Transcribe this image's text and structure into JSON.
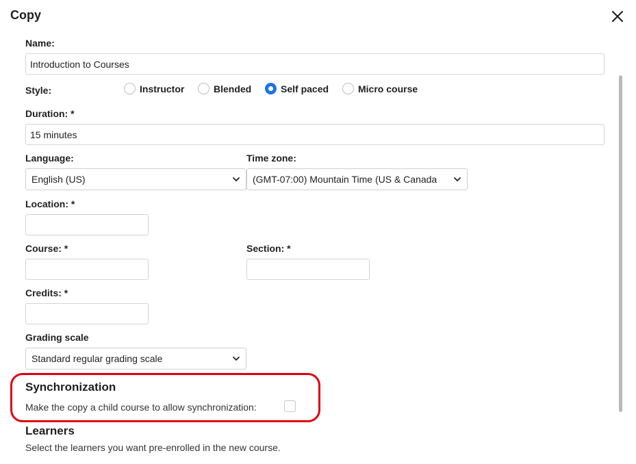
{
  "dialog": {
    "title": "Copy",
    "close_icon": "close-icon"
  },
  "form": {
    "name": {
      "label": "Name:",
      "value": "Introduction to Courses"
    },
    "style": {
      "label": "Style:",
      "options": [
        {
          "label": "Instructor",
          "checked": false
        },
        {
          "label": "Blended",
          "checked": false
        },
        {
          "label": "Self paced",
          "checked": true
        },
        {
          "label": "Micro course",
          "checked": false
        }
      ]
    },
    "duration": {
      "label": "Duration: *",
      "value": "15 minutes"
    },
    "language": {
      "label": "Language:",
      "value": "English (US)"
    },
    "timezone": {
      "label": "Time zone:",
      "value": "(GMT-07:00) Mountain Time (US & Canada"
    },
    "location": {
      "label": "Location: *",
      "value": ""
    },
    "course": {
      "label": "Course: *",
      "value": ""
    },
    "section": {
      "label": "Section: *",
      "value": ""
    },
    "credits": {
      "label": "Credits: *",
      "value": ""
    },
    "grading": {
      "label": "Grading scale",
      "value": "Standard regular grading scale"
    }
  },
  "synchronization": {
    "heading": "Synchronization",
    "checkbox_label": "Make the copy a child course to allow synchronization:",
    "checked": false,
    "highlight_color": "#e0000f"
  },
  "learners": {
    "heading": "Learners",
    "description": "Select the learners you want pre-enrolled in the new course."
  },
  "colors": {
    "accent": "#1a73e8"
  }
}
